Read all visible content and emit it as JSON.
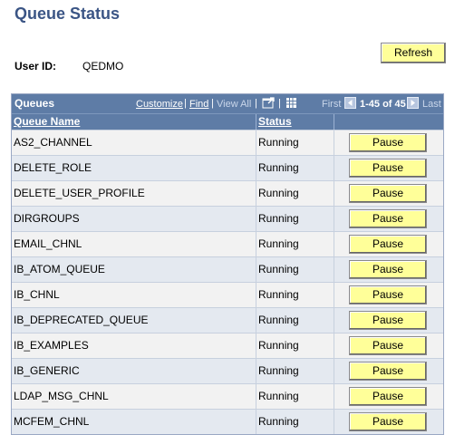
{
  "page": {
    "title": "Queue Status"
  },
  "user": {
    "label": "User ID:",
    "value": "QEDMO"
  },
  "refresh_label": "Refresh",
  "grid": {
    "title": "Queues",
    "customize": "Customize",
    "find": "Find",
    "view_all": "View All",
    "separator": "|",
    "first": "First",
    "range": "1-45 of 45",
    "last": "Last",
    "col_queue_name": "Queue Name",
    "col_status": "Status",
    "pause_label": "Pause",
    "rows": [
      {
        "name": "AS2_CHANNEL",
        "status": "Running"
      },
      {
        "name": "DELETE_ROLE",
        "status": "Running"
      },
      {
        "name": "DELETE_USER_PROFILE",
        "status": "Running"
      },
      {
        "name": "DIRGROUPS",
        "status": "Running"
      },
      {
        "name": "EMAIL_CHNL",
        "status": "Running"
      },
      {
        "name": "IB_ATOM_QUEUE",
        "status": "Running"
      },
      {
        "name": "IB_CHNL",
        "status": "Running"
      },
      {
        "name": "IB_DEPRECATED_QUEUE",
        "status": "Running"
      },
      {
        "name": "IB_EXAMPLES",
        "status": "Running"
      },
      {
        "name": "IB_GENERIC",
        "status": "Running"
      },
      {
        "name": "LDAP_MSG_CHNL",
        "status": "Running"
      },
      {
        "name": "MCFEM_CHNL",
        "status": "Running"
      }
    ]
  },
  "icons": {
    "new_window": "new-window-icon",
    "download": "download-grid-icon",
    "prev": "arrow-left-icon",
    "next": "arrow-right-icon"
  },
  "colors": {
    "title": "#3b5585",
    "grid_header": "#5e7ca6",
    "button": "#ffff99"
  }
}
